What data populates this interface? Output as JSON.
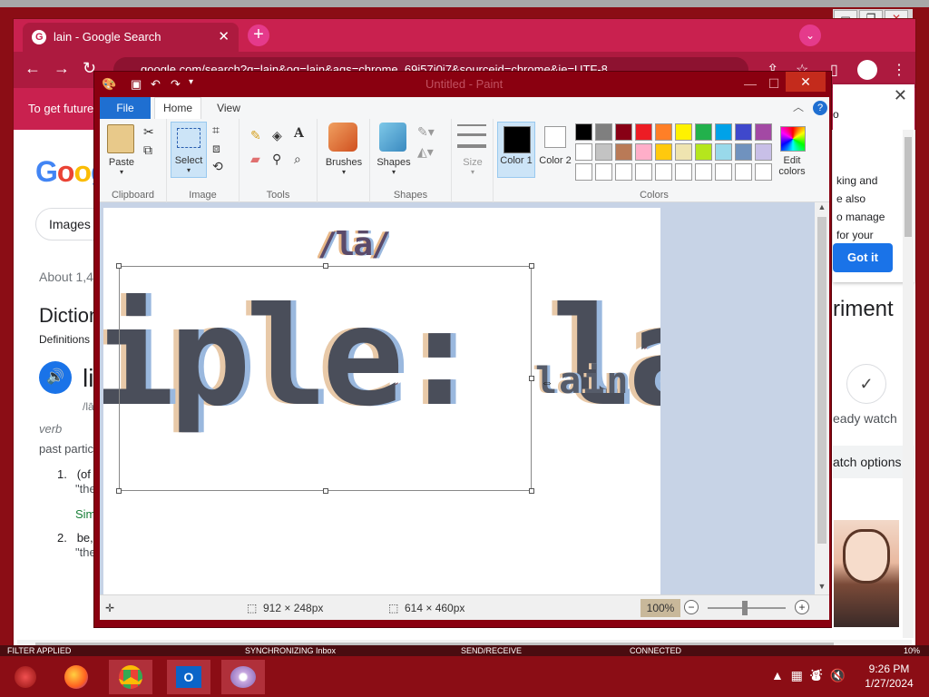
{
  "browser": {
    "tab_title": "lain - Google Search",
    "tab_close": "✕",
    "new_tab": "+",
    "url": "google.com/search?q=lain&oq=lain&aqs=chrome..69i57j0i7&sourceid=chrome&ie=UTF-8",
    "infobar_text": "To get future"
  },
  "google": {
    "logo": "Goog",
    "images_chip": "Images",
    "about": "About 1,4",
    "dictionary_heading": "Diction",
    "definitions_label": "Definitions",
    "word": "li",
    "pronunciation": "/lā",
    "pos": "verb",
    "past_participle": "past partic",
    "def1_num": "1.",
    "def1": "(of",
    "def1_quote": "\"the",
    "similar": "Sim",
    "def2_num": "2.",
    "def2": "be,",
    "def2_quote": "\"the"
  },
  "popup": {
    "partial_text": "king and\ne also\no manage\nfor your",
    "got_it": "Got it",
    "experiments_fragment": "riment",
    "ready_watch": "eady watch",
    "watch_options": "atch options"
  },
  "paint": {
    "title": "Untitled - Paint",
    "tabs": {
      "file": "File",
      "home": "Home",
      "view": "View"
    },
    "groups": {
      "clipboard": "Clipboard",
      "image": "Image",
      "tools": "Tools",
      "shapes": "Shapes",
      "colors": "Colors"
    },
    "buttons": {
      "paste": "Paste",
      "select": "Select",
      "brushes": "Brushes",
      "shapes": "Shapes",
      "size": "Size",
      "color1": "Color 1",
      "color2": "Color 2",
      "edit_colors": "Edit colors"
    },
    "palette": [
      "#000000",
      "#7f7f7f",
      "#880015",
      "#ed1c24",
      "#ff7f27",
      "#fff200",
      "#22b14c",
      "#00a2e8",
      "#3f48cc",
      "#a349a4",
      "#ffffff",
      "#c3c3c3",
      "#b97a57",
      "#ffaec9",
      "#ffc90e",
      "#efe4b0",
      "#b5e61d",
      "#99d9ea",
      "#7092be",
      "#c8bfe7",
      "#ffffff",
      "#ffffff",
      "#ffffff",
      "#ffffff",
      "#ffffff",
      "#ffffff",
      "#ffffff",
      "#ffffff",
      "#ffffff",
      "#ffffff"
    ],
    "canvas": {
      "big_text": "iple: lain",
      "small_text": "lain",
      "top_text": "/lā/"
    },
    "status": {
      "selection_size": "912 × 248px",
      "image_size": "614 × 460px",
      "zoom": "100%"
    }
  },
  "background_status": {
    "filter": "FILTER APPLIED",
    "sync": "SYNCHRONIZING   Inbox",
    "send": "SEND/RECEIVE",
    "connected": "CONNECTED",
    "percent": "10%"
  },
  "taskbar": {
    "time": "9:26 PM",
    "date": "1/27/2024"
  }
}
